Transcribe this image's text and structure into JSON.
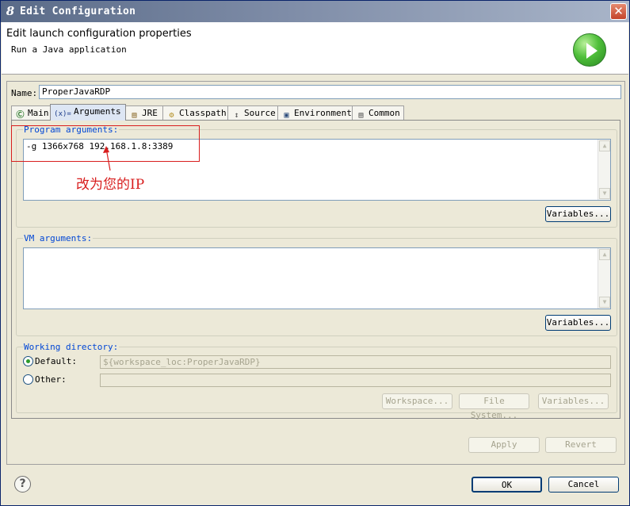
{
  "window": {
    "icon_glyph": "8",
    "title": "Edit Configuration",
    "close_glyph": "✕"
  },
  "header": {
    "title": "Edit launch configuration properties",
    "subtitle": "Run a Java application",
    "icon": "run-icon"
  },
  "name_field": {
    "label": "Name:",
    "value": "ProperJavaRDP"
  },
  "tabs": [
    {
      "label": "Main",
      "icon": "main-tab-icon",
      "glyph": "Ⓒ"
    },
    {
      "label": "Arguments",
      "icon": "arguments-tab-icon",
      "glyph": "(x)="
    },
    {
      "label": "JRE",
      "icon": "jre-tab-icon",
      "glyph": "▤"
    },
    {
      "label": "Classpath",
      "icon": "classpath-tab-icon",
      "glyph": "⚙"
    },
    {
      "label": "Source",
      "icon": "source-tab-icon",
      "glyph": "↕"
    },
    {
      "label": "Environment",
      "icon": "environment-tab-icon",
      "glyph": "▣"
    },
    {
      "label": "Common",
      "icon": "common-tab-icon",
      "glyph": "▤"
    }
  ],
  "program_arguments": {
    "label": "Program arguments:",
    "value": "-g 1366x768 192.168.1.8:3389",
    "variables_button": "Variables..."
  },
  "annotation": {
    "text": "改为您的IP",
    "color": "#d81e1e"
  },
  "vm_arguments": {
    "label": "VM arguments:",
    "value": "",
    "variables_button": "Variables..."
  },
  "working_directory": {
    "label": "Working directory:",
    "default_label": "Default:",
    "default_value": "${workspace_loc:ProperJavaRDP}",
    "other_label": "Other:",
    "other_value": "",
    "workspace_button": "Workspace...",
    "filesystem_button": "File System...",
    "variables_button": "Variables..."
  },
  "actions": {
    "apply": "Apply",
    "revert": "Revert",
    "ok": "OK",
    "cancel": "Cancel",
    "help_glyph": "?"
  },
  "colors": {
    "accent": "#0046d5",
    "annotation": "#d81e1e"
  }
}
